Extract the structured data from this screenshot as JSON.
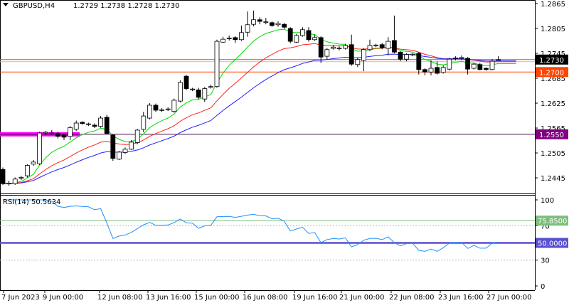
{
  "header": {
    "symbol_label": "GBPUSD,H4",
    "ohlc": "1.2729 1.2738 1.2728 1.2730"
  },
  "rsi_panel": {
    "title": "RSI(14) 50.5634",
    "level_a": "75.8500",
    "level_b": "50.0000"
  },
  "price_axis": {
    "ticks": [
      "1.2865",
      "1.2805",
      "1.2745",
      "1.2685",
      "1.2625",
      "1.2565",
      "1.2505",
      "1.2445"
    ],
    "labels": [
      {
        "text": "1.2730",
        "value": 1.273,
        "bg": "#000000",
        "fg": "#ffffff"
      },
      {
        "text": "1.2700",
        "value": 1.27,
        "bg": "#ff4500",
        "fg": "#ffffff"
      },
      {
        "text": "1.2550",
        "value": 1.255,
        "bg": "#800080",
        "fg": "#ffffff"
      }
    ]
  },
  "rsi_axis": {
    "ticks": [
      "100",
      "70",
      "30",
      "0"
    ]
  },
  "time_axis": {
    "labels": [
      "7 Jun 2023",
      "9 Jun 00:00",
      "12 Jun 08:00",
      "13 Jun 16:00",
      "15 Jun 00:00",
      "16 Jun 08:00",
      "19 Jun 16:00",
      "21 Jun 00:00",
      "22 Jun 08:00",
      "23 Jun 16:00",
      "27 Jun 00:00"
    ]
  },
  "colors": {
    "orange_line": "#ff4500",
    "purple_line": "#4b0a4b",
    "magenta_zone": "#ff00ff",
    "ma_fast": "#00dd00",
    "ma_mid": "#ff2020",
    "ma_slow": "#2020ff",
    "rsi": "#1e90ff",
    "rsi_level_a": "#7cbf7c",
    "rsi_level_b": "#5a4fcf"
  },
  "chart_data": {
    "type": "candlestick",
    "symbol": "GBPUSD",
    "timeframe": "H4",
    "ylim": [
      1.2415,
      1.2873
    ],
    "hlines": [
      1.273,
      1.27,
      1.255
    ],
    "rsi_levels": [
      75.85,
      50.0
    ],
    "rsi_ylim": [
      0,
      100
    ],
    "candles": [
      [
        1.2465,
        1.247,
        1.2428,
        1.2431
      ],
      [
        1.2431,
        1.2438,
        1.2426,
        1.2432
      ],
      [
        1.2431,
        1.2446,
        1.2428,
        1.2442
      ],
      [
        1.2445,
        1.245,
        1.244,
        1.2446
      ],
      [
        1.245,
        1.2478,
        1.2446,
        1.2475
      ],
      [
        1.2478,
        1.2488,
        1.2474,
        1.2483
      ],
      [
        1.2479,
        1.2556,
        1.2476,
        1.2553
      ],
      [
        1.2553,
        1.2558,
        1.2548,
        1.2555
      ],
      [
        1.2552,
        1.256,
        1.2548,
        1.2553
      ],
      [
        1.2552,
        1.2556,
        1.254,
        1.2545
      ],
      [
        1.2548,
        1.2552,
        1.2536,
        1.2543
      ],
      [
        1.2545,
        1.257,
        1.2536,
        1.2566
      ],
      [
        1.2562,
        1.2583,
        1.2558,
        1.2577
      ],
      [
        1.2579,
        1.2581,
        1.2573,
        1.2576
      ],
      [
        1.2574,
        1.2578,
        1.257,
        1.2575
      ],
      [
        1.2572,
        1.2576,
        1.2565,
        1.2569
      ],
      [
        1.2569,
        1.2594,
        1.2566,
        1.2589
      ],
      [
        1.2591,
        1.2597,
        1.255,
        1.2552
      ],
      [
        1.2548,
        1.255,
        1.2486,
        1.2492
      ],
      [
        1.249,
        1.251,
        1.2488,
        1.2507
      ],
      [
        1.2506,
        1.2518,
        1.2503,
        1.2514
      ],
      [
        1.2514,
        1.2536,
        1.2512,
        1.2531
      ],
      [
        1.253,
        1.2563,
        1.2526,
        1.256
      ],
      [
        1.2562,
        1.2604,
        1.2555,
        1.2594
      ],
      [
        1.2589,
        1.2625,
        1.2586,
        1.262
      ],
      [
        1.262,
        1.2624,
        1.2604,
        1.2608
      ],
      [
        1.2608,
        1.2613,
        1.2604,
        1.2609
      ],
      [
        1.261,
        1.2615,
        1.2606,
        1.2611
      ],
      [
        1.2605,
        1.2636,
        1.2602,
        1.2632
      ],
      [
        1.263,
        1.268,
        1.2627,
        1.2675
      ],
      [
        1.269,
        1.2693,
        1.2656,
        1.266
      ],
      [
        1.2658,
        1.2662,
        1.2654,
        1.2659
      ],
      [
        1.2657,
        1.2662,
        1.2634,
        1.2639
      ],
      [
        1.2635,
        1.2664,
        1.2628,
        1.266
      ],
      [
        1.2663,
        1.267,
        1.266,
        1.2665
      ],
      [
        1.2665,
        1.2778,
        1.2662,
        1.2774
      ],
      [
        1.2772,
        1.2785,
        1.277,
        1.2779
      ],
      [
        1.2781,
        1.2788,
        1.2776,
        1.2782
      ],
      [
        1.2783,
        1.2786,
        1.277,
        1.2778
      ],
      [
        1.2778,
        1.2812,
        1.2775,
        1.2795
      ],
      [
        1.2796,
        1.2846,
        1.2785,
        1.2814
      ],
      [
        1.2815,
        1.2848,
        1.281,
        1.2826
      ],
      [
        1.2826,
        1.2832,
        1.2815,
        1.2822
      ],
      [
        1.282,
        1.283,
        1.2815,
        1.2821
      ],
      [
        1.2819,
        1.2822,
        1.2809,
        1.2812
      ],
      [
        1.2814,
        1.2822,
        1.2809,
        1.2817
      ],
      [
        1.2815,
        1.2818,
        1.2804,
        1.2808
      ],
      [
        1.2805,
        1.2808,
        1.2769,
        1.2774
      ],
      [
        1.2772,
        1.2792,
        1.277,
        1.2788
      ],
      [
        1.2788,
        1.2808,
        1.2785,
        1.2802
      ],
      [
        1.28,
        1.2808,
        1.2773,
        1.2778
      ],
      [
        1.2778,
        1.279,
        1.2775,
        1.2783
      ],
      [
        1.2783,
        1.2786,
        1.2722,
        1.2736
      ],
      [
        1.2738,
        1.2758,
        1.273,
        1.2754
      ],
      [
        1.2757,
        1.2765,
        1.2754,
        1.276
      ],
      [
        1.2757,
        1.2762,
        1.2752,
        1.2758
      ],
      [
        1.2757,
        1.2768,
        1.2754,
        1.2764
      ],
      [
        1.2766,
        1.279,
        1.2715,
        1.2719
      ],
      [
        1.2718,
        1.2735,
        1.2712,
        1.273
      ],
      [
        1.2728,
        1.2757,
        1.2702,
        1.2754
      ],
      [
        1.2754,
        1.2778,
        1.275,
        1.2764
      ],
      [
        1.2764,
        1.2768,
        1.276,
        1.2765
      ],
      [
        1.2766,
        1.277,
        1.2755,
        1.2759
      ],
      [
        1.2757,
        1.2784,
        1.274,
        1.2774
      ],
      [
        1.2776,
        1.2836,
        1.2745,
        1.2748
      ],
      [
        1.2748,
        1.275,
        1.2726,
        1.2731
      ],
      [
        1.2731,
        1.2745,
        1.2726,
        1.2742
      ],
      [
        1.2742,
        1.2746,
        1.2738,
        1.2743
      ],
      [
        1.2745,
        1.2748,
        1.2694,
        1.2706
      ],
      [
        1.2706,
        1.2709,
        1.2692,
        1.27
      ],
      [
        1.27,
        1.2728,
        1.2692,
        1.2709
      ],
      [
        1.2711,
        1.2726,
        1.2694,
        1.2697
      ],
      [
        1.2699,
        1.2716,
        1.2696,
        1.2711
      ],
      [
        1.2707,
        1.2734,
        1.2704,
        1.2731
      ],
      [
        1.2733,
        1.2738,
        1.2728,
        1.2734
      ],
      [
        1.2733,
        1.274,
        1.2729,
        1.2735
      ],
      [
        1.2733,
        1.2736,
        1.2694,
        1.2707
      ],
      [
        1.2709,
        1.2722,
        1.2706,
        1.2719
      ],
      [
        1.2718,
        1.2722,
        1.2704,
        1.2706
      ],
      [
        1.2709,
        1.2711,
        1.2703,
        1.2706
      ],
      [
        1.2706,
        1.2731,
        1.2704,
        1.2726
      ],
      [
        1.2729,
        1.2738,
        1.2728,
        1.273
      ]
    ]
  }
}
